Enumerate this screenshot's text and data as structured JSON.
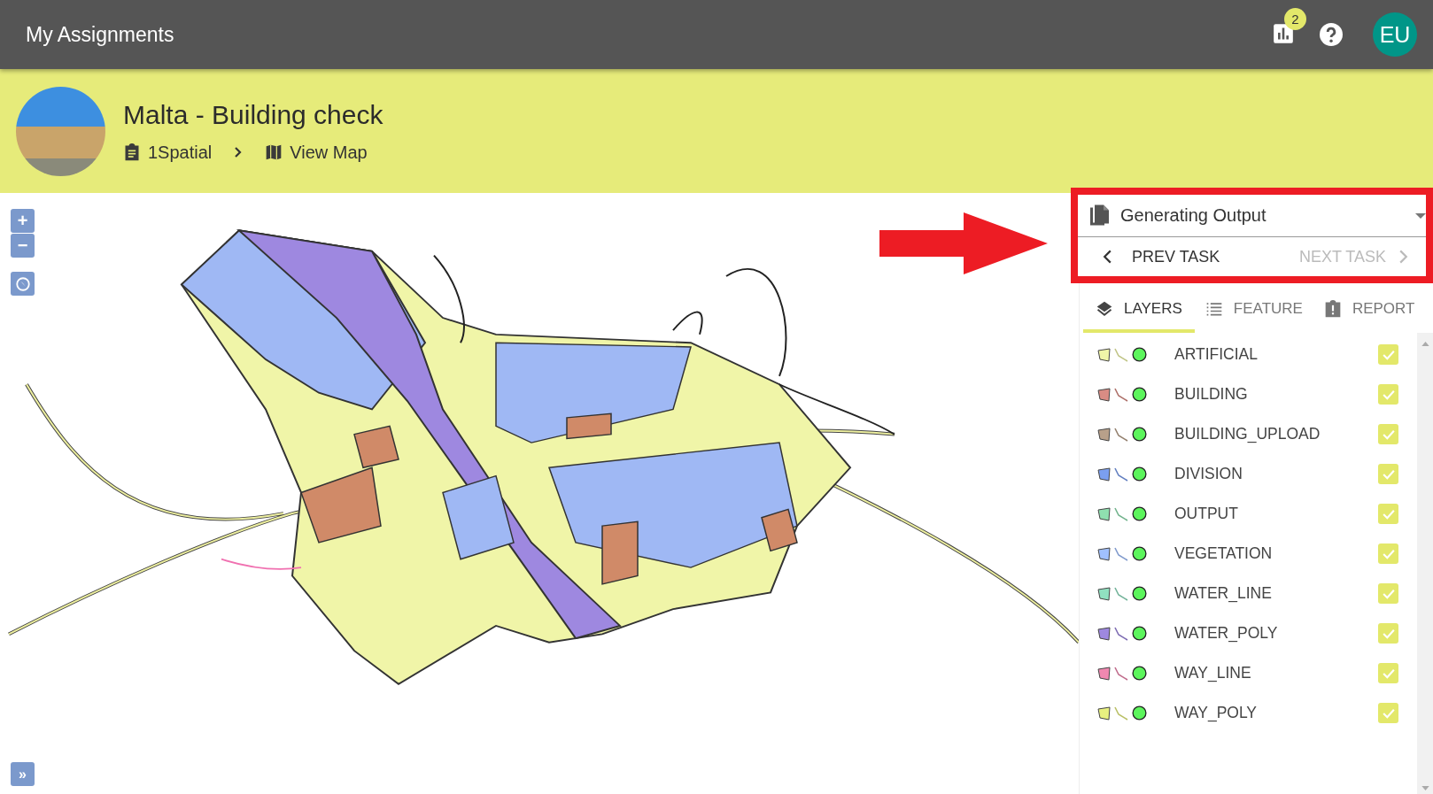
{
  "app_bar": {
    "title": "My Assignments",
    "stats_badge": "2",
    "avatar_initials": "EU"
  },
  "project": {
    "title": "Malta - Building check",
    "breadcrumbs": [
      {
        "label": "1Spatial",
        "kind": "clipboard"
      },
      {
        "label": "View Map",
        "kind": "map"
      }
    ]
  },
  "map_controls": {
    "zoom_in": "+",
    "zoom_out": "−",
    "expand": "»"
  },
  "task": {
    "name": "Generating Output",
    "prev": {
      "label": "PREV TASK",
      "disabled": false
    },
    "next": {
      "label": "NEXT TASK",
      "disabled": true
    }
  },
  "tabs": [
    {
      "label": "LAYERS",
      "kind": "layers",
      "selected": true
    },
    {
      "label": "FEATURE",
      "kind": "list",
      "selected": false
    },
    {
      "label": "REPORT",
      "kind": "report",
      "selected": false
    }
  ],
  "layers": [
    {
      "name": "ARTIFICIAL",
      "color": "#f0f5a8",
      "checked": true
    },
    {
      "name": "BUILDING",
      "color": "#d98c84",
      "checked": true
    },
    {
      "name": "BUILDING_UPLOAD",
      "color": "#b8a08a",
      "checked": true
    },
    {
      "name": "DIVISION",
      "color": "#7b9ff0",
      "checked": true
    },
    {
      "name": "OUTPUT",
      "color": "#8fe0b0",
      "checked": true
    },
    {
      "name": "VEGETATION",
      "color": "#a0c0ff",
      "checked": true
    },
    {
      "name": "WATER_LINE",
      "color": "#90e0c0",
      "checked": true
    },
    {
      "name": "WATER_POLY",
      "color": "#9e88e0",
      "checked": true
    },
    {
      "name": "WAY_LINE",
      "color": "#f088b0",
      "checked": true
    },
    {
      "name": "WAY_POLY",
      "color": "#e8f080",
      "checked": true
    }
  ]
}
